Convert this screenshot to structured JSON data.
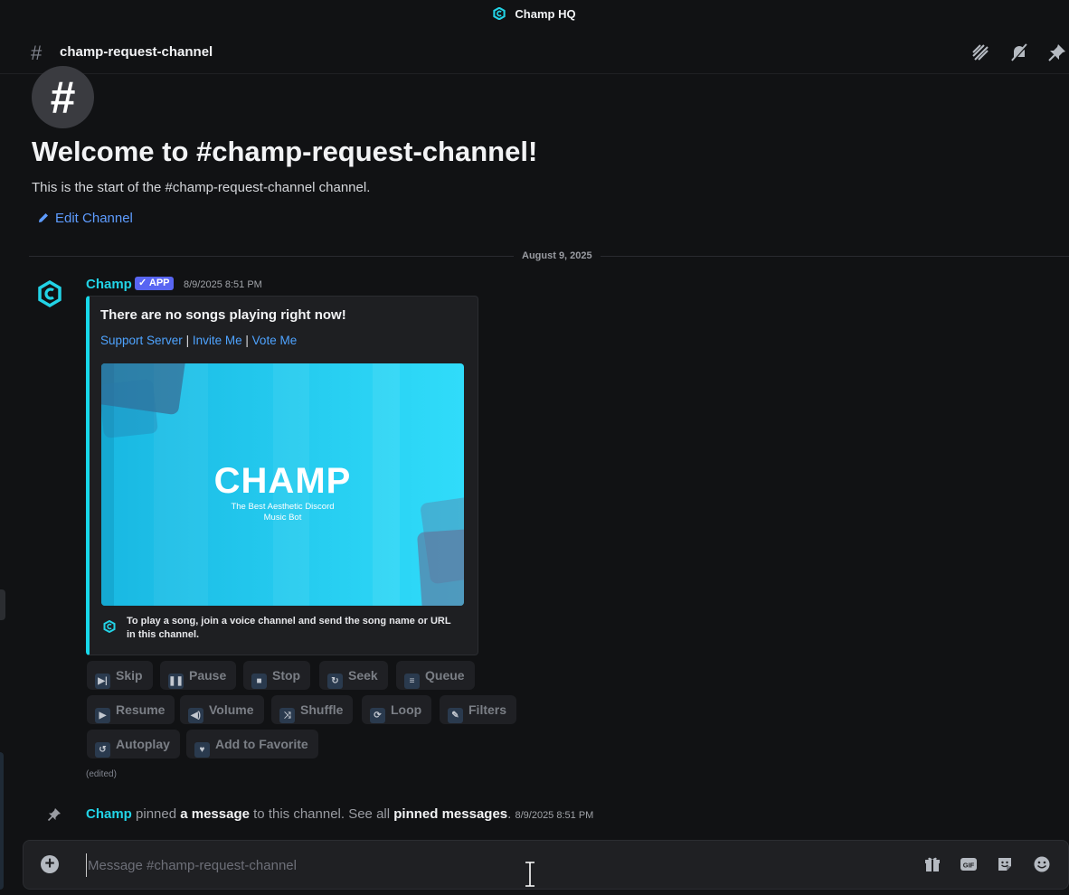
{
  "window": {
    "title": "Champ HQ"
  },
  "header": {
    "channel_name": "champ-request-channel"
  },
  "welcome": {
    "title": "Welcome to #champ-request-channel!",
    "subtitle": "This is the start of the #champ-request-channel channel.",
    "edit_label": "Edit Channel"
  },
  "divider": {
    "date": "August 9, 2025"
  },
  "message": {
    "author": "Champ",
    "badge": "APP",
    "timestamp": "8/9/2025 8:51 PM",
    "embed": {
      "title": "There are no songs playing right now!",
      "link_support": "Support Server",
      "link_invite": "Invite Me",
      "link_vote": "Vote Me",
      "separator": "|",
      "image_wordmark": "CHAMP",
      "image_tagline_1": "The Best Aesthetic Discord",
      "image_tagline_2": "Music Bot",
      "footer": "To play a song, join a voice channel and send the song name or URL in this channel."
    },
    "buttons": [
      {
        "label": "Skip",
        "icon": "skip-icon"
      },
      {
        "label": "Pause",
        "icon": "pause-icon"
      },
      {
        "label": "Stop",
        "icon": "stop-icon"
      },
      {
        "label": "Seek",
        "icon": "seek-icon"
      },
      {
        "label": "Queue",
        "icon": "queue-icon"
      },
      {
        "label": "Resume",
        "icon": "play-icon"
      },
      {
        "label": "Volume",
        "icon": "volume-icon"
      },
      {
        "label": "Shuffle",
        "icon": "shuffle-icon"
      },
      {
        "label": "Loop",
        "icon": "loop-icon"
      },
      {
        "label": "Filters",
        "icon": "filters-icon"
      },
      {
        "label": "Autoplay",
        "icon": "autoplay-icon"
      },
      {
        "label": "Add to Favorite",
        "icon": "heart-icon"
      }
    ],
    "edited": "(edited)"
  },
  "system_message": {
    "author": "Champ",
    "text_1": "pinned",
    "link_1": "a message",
    "text_2": "to this channel. See all",
    "link_2": "pinned messages",
    "text_3": ".",
    "timestamp": "8/9/2025 8:51 PM"
  },
  "composer": {
    "placeholder": "Message #champ-request-channel"
  },
  "colors": {
    "accent": "#22d3e6",
    "background": "#111214",
    "link": "#4ea3ff",
    "badge": "#5865f2"
  }
}
